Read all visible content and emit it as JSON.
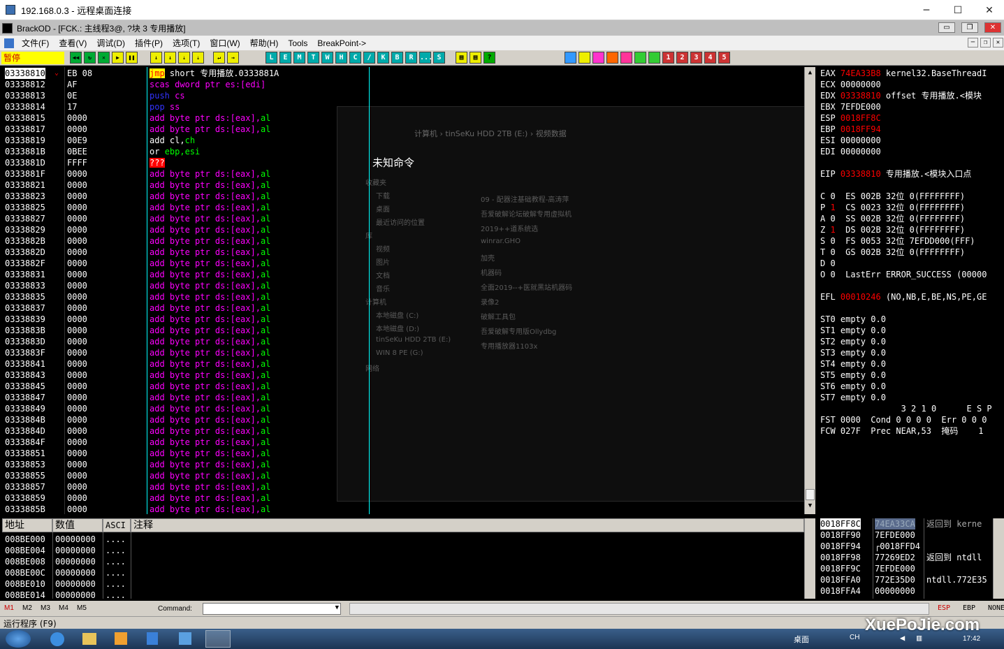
{
  "rdp": {
    "title": "192.168.0.3 - 远程桌面连接",
    "min": "─",
    "max": "☐",
    "close": "✕"
  },
  "od": {
    "title": "BrackOD - [FCK.: 主线程3@, ?块 3 专用播放]"
  },
  "menu": [
    "文件(F)",
    "查看(V)",
    "调试(D)",
    "插件(P)",
    "选项(T)",
    "窗口(W)",
    "帮助(H)",
    "Tools",
    "BreakPoint->"
  ],
  "toolbar": {
    "status": "暂停",
    "letters": [
      "L",
      "E",
      "M",
      "T",
      "W",
      "H",
      "C",
      "/",
      "K",
      "B",
      "R",
      "...",
      "S"
    ],
    "nums": [
      "1",
      "2",
      "3",
      "4",
      "5"
    ]
  },
  "cpu": {
    "unknown_cmd": "未知命令",
    "rows": [
      {
        "addr": "03338810",
        "hex": "EB 08",
        "ins": [
          [
            "jmp",
            "#ff0",
            "#f0f"
          ],
          [
            " short 专用播放.0333881A",
            "#fff"
          ]
        ]
      },
      {
        "addr": "03338812",
        "hex": "AF",
        "ins": [
          [
            "scas ",
            "#f0f"
          ],
          [
            "dword ptr es:[edi]",
            "#f0f"
          ]
        ]
      },
      {
        "addr": "03338813",
        "hex": "0E",
        "ins": [
          [
            "push ",
            "#33f"
          ],
          [
            "cs",
            "#f0f"
          ]
        ]
      },
      {
        "addr": "03338814",
        "hex": "17",
        "ins": [
          [
            "pop ",
            "#33f"
          ],
          [
            "ss",
            "#f0f"
          ]
        ]
      },
      {
        "addr": "03338815",
        "hex": "0000",
        "ins": [
          [
            "add ",
            "#f0f"
          ],
          [
            "byte ptr ds:[eax],",
            "#f0f"
          ],
          [
            "al",
            "#0f0"
          ]
        ]
      },
      {
        "addr": "03338817",
        "hex": "0000",
        "ins": [
          [
            "add ",
            "#f0f"
          ],
          [
            "byte ptr ds:[eax],",
            "#f0f"
          ],
          [
            "al",
            "#0f0"
          ]
        ]
      },
      {
        "addr": "03338819",
        "hex": "00E9",
        "ins": [
          [
            "add ",
            "#fff"
          ],
          [
            "cl,",
            "#fff"
          ],
          [
            "ch",
            "#0f0"
          ]
        ]
      },
      {
        "addr": "0333881B",
        "hex": "0BEE",
        "ins": [
          [
            "or ",
            "#fff"
          ],
          [
            "ebp,esi",
            "#0f0"
          ]
        ]
      },
      {
        "addr": "0333881D",
        "hex": "FFFF",
        "ins": [
          [
            "???",
            "#fff"
          ]
        ]
      },
      {
        "addr": "0333881F",
        "hex": "0000"
      },
      {
        "addr": "03338821",
        "hex": "0000"
      },
      {
        "addr": "03338823",
        "hex": "0000"
      },
      {
        "addr": "03338825",
        "hex": "0000"
      },
      {
        "addr": "03338827",
        "hex": "0000"
      },
      {
        "addr": "03338829",
        "hex": "0000"
      },
      {
        "addr": "0333882B",
        "hex": "0000"
      },
      {
        "addr": "0333882D",
        "hex": "0000"
      },
      {
        "addr": "0333882F",
        "hex": "0000"
      },
      {
        "addr": "03338831",
        "hex": "0000"
      },
      {
        "addr": "03338833",
        "hex": "0000"
      },
      {
        "addr": "03338835",
        "hex": "0000"
      },
      {
        "addr": "03338837",
        "hex": "0000"
      },
      {
        "addr": "03338839",
        "hex": "0000"
      },
      {
        "addr": "0333883B",
        "hex": "0000"
      },
      {
        "addr": "0333883D",
        "hex": "0000"
      },
      {
        "addr": "0333883F",
        "hex": "0000"
      },
      {
        "addr": "03338841",
        "hex": "0000"
      },
      {
        "addr": "03338843",
        "hex": "0000"
      },
      {
        "addr": "03338845",
        "hex": "0000"
      },
      {
        "addr": "03338847",
        "hex": "0000"
      },
      {
        "addr": "03338849",
        "hex": "0000"
      },
      {
        "addr": "0333884B",
        "hex": "0000"
      },
      {
        "addr": "0333884D",
        "hex": "0000"
      },
      {
        "addr": "0333884F",
        "hex": "0000"
      },
      {
        "addr": "03338851",
        "hex": "0000"
      },
      {
        "addr": "03338853",
        "hex": "0000"
      },
      {
        "addr": "03338855",
        "hex": "0000"
      },
      {
        "addr": "03338857",
        "hex": "0000"
      },
      {
        "addr": "03338859",
        "hex": "0000"
      },
      {
        "addr": "0333885B",
        "hex": "0000"
      }
    ]
  },
  "regs": [
    [
      "EAX ",
      [
        [
          "74EA33B8",
          "#f00"
        ],
        [
          " kernel32.BaseThreadI",
          "#fff"
        ]
      ]
    ],
    [
      "ECX ",
      [
        [
          "00000000",
          "#fff"
        ]
      ]
    ],
    [
      "EDX ",
      [
        [
          "03338810",
          "#f00"
        ],
        [
          " offset 专用播放.<模块",
          "#fff"
        ]
      ]
    ],
    [
      "EBX ",
      [
        [
          "7EFDE000",
          "#fff"
        ]
      ]
    ],
    [
      "ESP ",
      [
        [
          "0018FF8C",
          "#f00"
        ]
      ]
    ],
    [
      "EBP ",
      [
        [
          "0018FF94",
          "#f00"
        ]
      ]
    ],
    [
      "ESI ",
      [
        [
          "00000000",
          "#fff"
        ]
      ]
    ],
    [
      "EDI ",
      [
        [
          "00000000",
          "#fff"
        ]
      ]
    ],
    [
      "",
      []
    ],
    [
      "EIP ",
      [
        [
          "03338810",
          "#f00"
        ],
        [
          " 专用播放.<模块入口点",
          "#fff"
        ]
      ]
    ],
    [
      "",
      []
    ],
    [
      "C 0  ",
      [
        [
          "ES 002B 32位 0(FFFFFFFF)",
          "#fff"
        ]
      ]
    ],
    [
      "P ",
      [
        [
          "1",
          "#f00"
        ],
        [
          "  CS 0023 32位 0(FFFFFFFF)",
          "#fff"
        ]
      ]
    ],
    [
      "A 0  ",
      [
        [
          "SS 002B 32位 0(FFFFFFFF)",
          "#fff"
        ]
      ]
    ],
    [
      "Z ",
      [
        [
          "1",
          "#f00"
        ],
        [
          "  DS 002B 32位 0(FFFFFFFF)",
          "#fff"
        ]
      ]
    ],
    [
      "S 0  ",
      [
        [
          "FS 0053 32位 7EFDD000(FFF)",
          "#fff"
        ]
      ]
    ],
    [
      "T 0  ",
      [
        [
          "GS 002B 32位 0(FFFFFFFF)",
          "#fff"
        ]
      ]
    ],
    [
      "D 0",
      []
    ],
    [
      "O 0  ",
      [
        [
          "LastErr ERROR_SUCCESS (00000",
          "#fff"
        ]
      ]
    ],
    [
      "",
      []
    ],
    [
      "EFL ",
      [
        [
          "00010246",
          "#f00"
        ],
        [
          " (NO,NB,E,BE,NS,PE,GE",
          "#fff"
        ]
      ]
    ],
    [
      "",
      []
    ],
    [
      "ST0 ",
      [
        [
          "empty 0.0",
          "#fff"
        ]
      ]
    ],
    [
      "ST1 ",
      [
        [
          "empty 0.0",
          "#fff"
        ]
      ]
    ],
    [
      "ST2 ",
      [
        [
          "empty 0.0",
          "#fff"
        ]
      ]
    ],
    [
      "ST3 ",
      [
        [
          "empty 0.0",
          "#fff"
        ]
      ]
    ],
    [
      "ST4 ",
      [
        [
          "empty 0.0",
          "#fff"
        ]
      ]
    ],
    [
      "ST5 ",
      [
        [
          "empty 0.0",
          "#fff"
        ]
      ]
    ],
    [
      "ST6 ",
      [
        [
          "empty 0.0",
          "#fff"
        ]
      ]
    ],
    [
      "ST7 ",
      [
        [
          "empty 0.0",
          "#fff"
        ]
      ]
    ],
    [
      "                3 2 1 0      E S P",
      []
    ],
    [
      "FST ",
      [
        [
          "0000  Cond 0 0 0 0  Err 0 0 0",
          "#fff"
        ]
      ]
    ],
    [
      "FCW ",
      [
        [
          "027F  Prec NEAR,53  掩码    1",
          "#fff"
        ]
      ]
    ]
  ],
  "dump": {
    "headers": [
      "地址",
      "数值",
      "ASCI",
      "注释"
    ],
    "rows": [
      [
        "008BE000",
        "00000000",
        "...."
      ],
      [
        "008BE004",
        "00000000",
        "...."
      ],
      [
        "008BE008",
        "00000000",
        "...."
      ],
      [
        "008BE00C",
        "00000000",
        "...."
      ],
      [
        "008BE010",
        "00000000",
        "...."
      ],
      [
        "008BE014",
        "00000000",
        "...."
      ]
    ]
  },
  "stack": {
    "rows": [
      [
        "0018FF8C",
        "74EA33CA",
        "返回到 kerne"
      ],
      [
        "0018FF90",
        "7EFDE000",
        ""
      ],
      [
        "0018FF94",
        "┌0018FFD4",
        ""
      ],
      [
        "0018FF98",
        "77269ED2",
        "返回到 ntdll"
      ],
      [
        "0018FF9C",
        "7EFDE000",
        ""
      ],
      [
        "0018FFA0",
        "772E35D0",
        "ntdll.772E35"
      ],
      [
        "0018FFA4",
        "00000000",
        ""
      ]
    ]
  },
  "cmd": {
    "marks": [
      "M1",
      "M2",
      "M3",
      "M4",
      "M5"
    ],
    "label": "Command:",
    "right": [
      "ESP",
      "EBP",
      "NONE"
    ]
  },
  "status": "运行程序 (F9)",
  "taskbar": {
    "desktop": "桌面",
    "lang": "CH",
    "clock": "17:42",
    "watermark": "XuePoJie.com"
  },
  "ghost": {
    "path": "计算机 › tinSeKu HDD 2TB (E:) › 视频数据",
    "items": [
      "收藏夹",
      "下载",
      "桌面",
      "最近访问的位置",
      "库",
      "视频",
      "图片",
      "文档",
      "音乐",
      "计算机",
      "本地磁盘 (C:)",
      "本地磁盘 (D:)",
      "tinSeKu HDD 2TB (E:)",
      "WIN 8 PE (G:)",
      "网络"
    ],
    "files": [
      "09 - 配器注基础教程-高涛萍",
      "吾爱破解论坛破解专用虚拟机",
      "2019++道系统选",
      "winrar.GHO",
      "加壳",
      "机器码",
      "全面2019--+医就黑站机器码",
      "录像2",
      "破解工具包",
      "吾爱破解专用版Ollydbg",
      "专用播放器1103x"
    ]
  }
}
